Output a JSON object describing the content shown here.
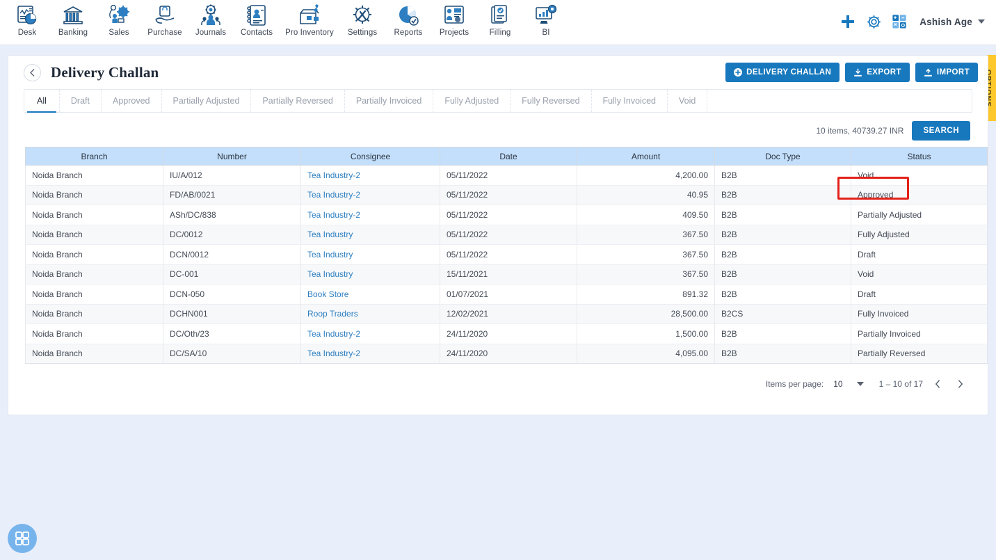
{
  "topnav": {
    "items": [
      {
        "label": "Desk",
        "icon": "dashboard-icon"
      },
      {
        "label": "Banking",
        "icon": "bank-icon"
      },
      {
        "label": "Sales",
        "icon": "sales-icon"
      },
      {
        "label": "Purchase",
        "icon": "purchase-icon"
      },
      {
        "label": "Journals",
        "icon": "journals-icon"
      },
      {
        "label": "Contacts",
        "icon": "contacts-icon"
      },
      {
        "label": "Pro Inventory",
        "icon": "inventory-icon"
      },
      {
        "label": "Settings",
        "icon": "settings-icon"
      },
      {
        "label": "Reports",
        "icon": "reports-icon"
      },
      {
        "label": "Projects",
        "icon": "projects-icon"
      },
      {
        "label": "Filling",
        "icon": "filling-icon"
      },
      {
        "label": "BI",
        "icon": "bi-icon"
      }
    ],
    "add_icon": "plus-icon",
    "gear_icon": "gear-icon",
    "calculator_icon": "calculator-icon",
    "user": "Ashish Age",
    "user_caret": "chevron-down-icon"
  },
  "header": {
    "back_icon": "chevron-left-icon",
    "title": "Delivery Challan",
    "buttons": [
      {
        "label": "DELIVERY CHALLAN",
        "icon": "plus-circle-icon",
        "name": "delivery-challan-button"
      },
      {
        "label": "EXPORT",
        "icon": "download-icon",
        "name": "export-button"
      },
      {
        "label": "IMPORT",
        "icon": "upload-icon",
        "name": "import-button"
      }
    ]
  },
  "options_tab": {
    "label": "OPTIONS"
  },
  "tabs": [
    {
      "label": "All",
      "active": true
    },
    {
      "label": "Draft",
      "active": false
    },
    {
      "label": "Approved",
      "active": false
    },
    {
      "label": "Partially Adjusted",
      "active": false
    },
    {
      "label": "Partially Reversed",
      "active": false
    },
    {
      "label": "Partially Invoiced",
      "active": false
    },
    {
      "label": "Fully Adjusted",
      "active": false
    },
    {
      "label": "Fully Reversed",
      "active": false
    },
    {
      "label": "Fully Invoiced",
      "active": false
    },
    {
      "label": "Void",
      "active": false
    }
  ],
  "search_strip": {
    "summary": "10 items, 40739.27 INR",
    "search_label": "SEARCH"
  },
  "table": {
    "columns": [
      "Branch",
      "Number",
      "Consignee",
      "Date",
      "Amount",
      "Doc Type",
      "Status"
    ],
    "rows": [
      {
        "branch": "Noida Branch",
        "number": "IU/A/012",
        "consignee": "Tea Industry-2",
        "date": "05/11/2022",
        "amount": "4,200.00",
        "doc_type": "B2B",
        "status": "Void"
      },
      {
        "branch": "Noida Branch",
        "number": "FD/AB/0021",
        "consignee": "Tea Industry-2",
        "date": "05/11/2022",
        "amount": "40.95",
        "doc_type": "B2B",
        "status": "Approved"
      },
      {
        "branch": "Noida Branch",
        "number": "ASh/DC/838",
        "consignee": "Tea Industry-2",
        "date": "05/11/2022",
        "amount": "409.50",
        "doc_type": "B2B",
        "status": "Partially Adjusted"
      },
      {
        "branch": "Noida Branch",
        "number": "DC/0012",
        "consignee": "Tea Industry",
        "date": "05/11/2022",
        "amount": "367.50",
        "doc_type": "B2B",
        "status": "Fully Adjusted"
      },
      {
        "branch": "Noida Branch",
        "number": "DCN/0012",
        "consignee": "Tea Industry",
        "date": "05/11/2022",
        "amount": "367.50",
        "doc_type": "B2B",
        "status": "Draft"
      },
      {
        "branch": "Noida Branch",
        "number": "DC-001",
        "consignee": "Tea Industry",
        "date": "15/11/2021",
        "amount": "367.50",
        "doc_type": "B2B",
        "status": "Void"
      },
      {
        "branch": "Noida Branch",
        "number": "DCN-050",
        "consignee": "Book Store",
        "date": "01/07/2021",
        "amount": "891.32",
        "doc_type": "B2B",
        "status": "Draft"
      },
      {
        "branch": "Noida Branch",
        "number": "DCHN001",
        "consignee": "Roop Traders",
        "date": "12/02/2021",
        "amount": "28,500.00",
        "doc_type": "B2CS",
        "status": "Fully Invoiced"
      },
      {
        "branch": "Noida Branch",
        "number": "DC/Oth/23",
        "consignee": "Tea Industry-2",
        "date": "24/11/2020",
        "amount": "1,500.00",
        "doc_type": "B2B",
        "status": "Partially Invoiced"
      },
      {
        "branch": "Noida Branch",
        "number": "DC/SA/10",
        "consignee": "Tea Industry-2",
        "date": "24/11/2020",
        "amount": "4,095.00",
        "doc_type": "B2B",
        "status": "Partially Reversed"
      }
    ]
  },
  "paginator": {
    "items_per_page_label": "Items per page:",
    "items_per_page_value": "10",
    "range": "1 – 10 of 17",
    "prev_icon": "chevron-left-icon",
    "next_icon": "chevron-right-icon"
  },
  "fab": {
    "icon": "grid-apps-icon"
  },
  "colors": {
    "accent": "#1878bd",
    "table_header": "#c3dffb",
    "options_tab": "#fdc82b",
    "highlight": "#e32119",
    "page_bg": "#e9eefb"
  }
}
